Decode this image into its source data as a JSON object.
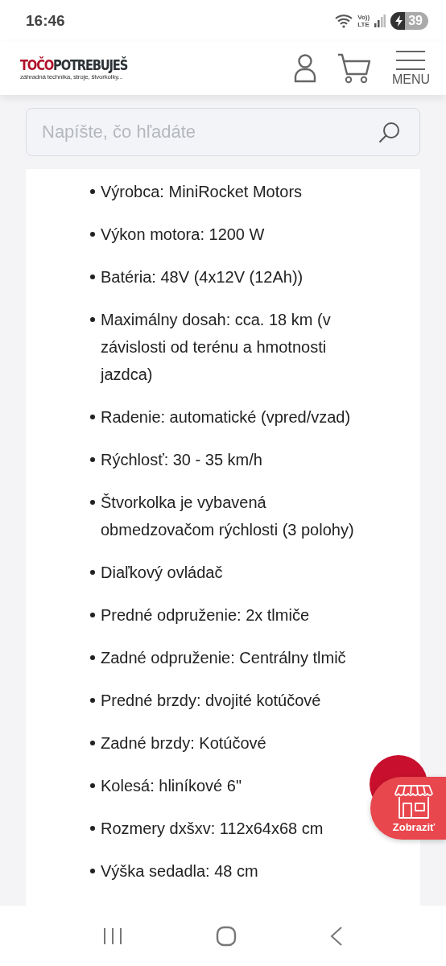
{
  "status_bar": {
    "time": "16:46",
    "volte": "Vo))",
    "network": "LTE",
    "battery": "39",
    "charging": true
  },
  "header": {
    "logo_brand_a": "TOČO",
    "logo_brand_b": "POTREBUJEŠ",
    "logo_tagline": "záhradná technika, stroje, štvorkolky...",
    "menu_label": "MENU"
  },
  "search": {
    "placeholder": "Napíšte, čo hľadáte"
  },
  "specs": [
    {
      "text": "Výrobca: MiniRocket Motors"
    },
    {
      "text": "Výkon motora: 1200 W"
    },
    {
      "text": "Batéria: 48V (4x12V (12Ah))"
    },
    {
      "text": "Maximálny dosah: cca. 18 km (v závislosti od terénu a hmotnosti jazdca)"
    },
    {
      "text": "Radenie: automatické (vpred/vzad)"
    },
    {
      "text": "Rýchlosť: 30 - 35 km/h"
    },
    {
      "text": "Štvorkolka je vybavená obmedzovačom rýchlosti (3 polohy)"
    },
    {
      "text": "Diaľkový ovládač"
    },
    {
      "text": "Predné odpruženie: 2x tlmiče"
    },
    {
      "text": "Zadné odpruženie: Centrálny tlmič"
    },
    {
      "text": "Predné brzdy: dvojité kotúčové"
    },
    {
      "text": "Zadné brzdy: Kotúčové"
    },
    {
      "text": "Kolesá: hliníkové 6\""
    },
    {
      "text": "Rozmery dxšxv: 112x64x68 cm"
    },
    {
      "text": "Výška sedadla: 48 cm"
    }
  ],
  "store_button": {
    "label": "Zobraziť"
  }
}
